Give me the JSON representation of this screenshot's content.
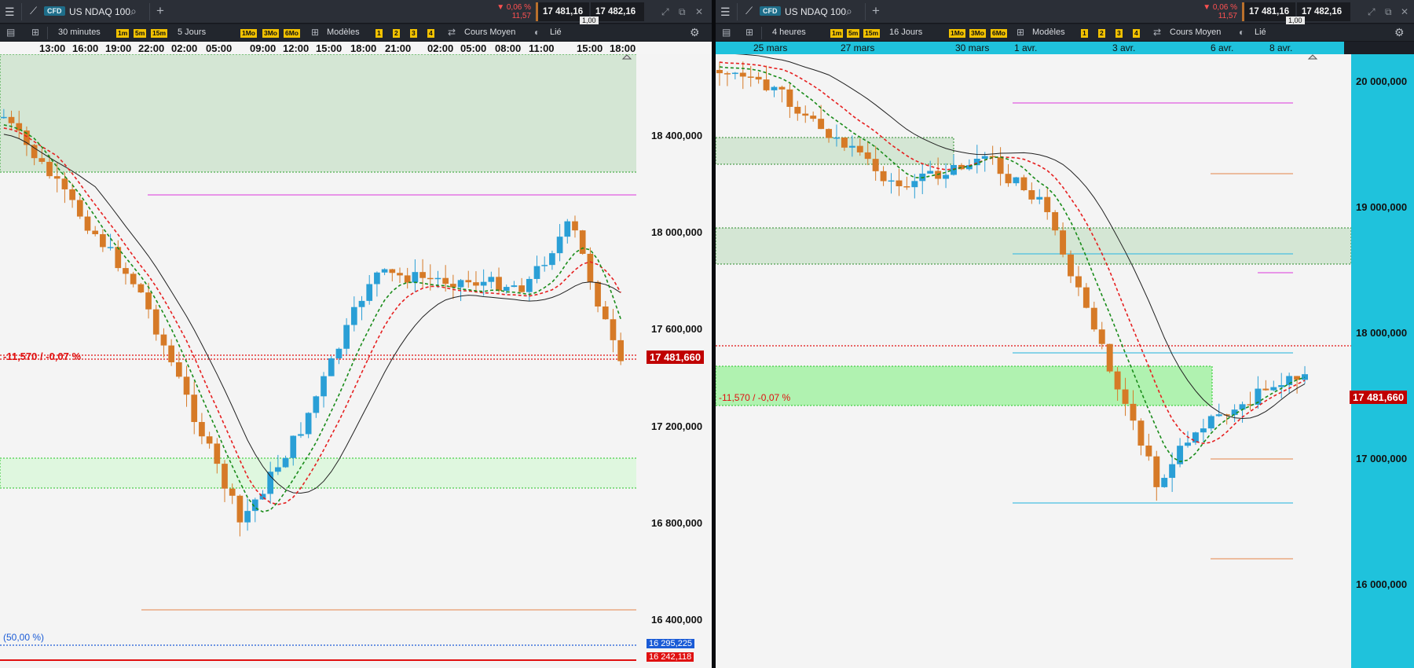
{
  "left": {
    "instrument": {
      "badge": "CFD",
      "name": "US NDAQ 100"
    },
    "change": {
      "pct": "▼ 0,06 %",
      "abs": "11,57"
    },
    "bid": "17 481,16",
    "ask": "17 482,16",
    "spread": "1,00",
    "toolbar": {
      "timeframe": "30 minutes",
      "tf_buttons": [
        "1m",
        "5m",
        "15m"
      ],
      "range": "5 Jours",
      "range_buttons": [
        "1Mo",
        "3Mo",
        "6Mo"
      ],
      "templates": "Modèles",
      "slots": [
        "1",
        "2",
        "3",
        "4"
      ],
      "price_type": "Cours Moyen",
      "linked": "Lié"
    },
    "time_ticks": [
      "13:00",
      "16:00",
      "19:00",
      "22:00",
      "02:00",
      "05:00",
      "09:00",
      "12:00",
      "15:00",
      "18:00",
      "21:00",
      "02:00",
      "05:00",
      "08:00",
      "11:00",
      "15:00",
      "18:00"
    ],
    "y_ticks": [
      "18 400,000",
      "18 000,000",
      "17 600,000",
      "17 200,000",
      "16 800,000",
      "16 400,000"
    ],
    "price_label": "17 481,660",
    "change_label": "-11,570 / -0,07 %",
    "fib_label": "(50,00 %)",
    "label_blue": "16 295,225",
    "label_red": "16 242,118"
  },
  "right": {
    "instrument": {
      "badge": "CFD",
      "name": "US NDAQ 100"
    },
    "change": {
      "pct": "▼ 0,06 %",
      "abs": "11,57"
    },
    "bid": "17 481,16",
    "ask": "17 482,16",
    "spread": "1,00",
    "toolbar": {
      "timeframe": "4 heures",
      "tf_buttons": [
        "1m",
        "5m",
        "15m"
      ],
      "range": "16 Jours",
      "range_buttons": [
        "1Mo",
        "3Mo",
        "6Mo"
      ],
      "templates": "Modèles",
      "slots": [
        "1",
        "2",
        "3",
        "4"
      ],
      "price_type": "Cours Moyen",
      "linked": "Lié"
    },
    "time_ticks": [
      "25 mars",
      "27 mars",
      "30 mars",
      "1 avr.",
      "3 avr.",
      "6 avr.",
      "8 avr."
    ],
    "y_ticks": [
      "20 000,000",
      "19 000,000",
      "18 000,000",
      "17 000,000",
      "16 000,000"
    ],
    "price_label": "17 481,660",
    "change_label": "-11,570 / -0,07 %"
  },
  "colors": {
    "bull": "#2a9fd6",
    "bear": "#d67a27",
    "ema_fast": "#1a8c1a",
    "ema_mid": "#e62020",
    "sma": "#222222",
    "accent_red": "#c00000",
    "axis_cyan": "#1fc2dc"
  },
  "icons": [
    "menu-icon",
    "chart-icon",
    "search-icon",
    "plus-icon",
    "layout-icon",
    "templates-icon",
    "price-type-icon",
    "link-icon",
    "gear-icon",
    "minimize-icon",
    "maximize-icon",
    "popout-icon",
    "close-icon"
  ]
}
